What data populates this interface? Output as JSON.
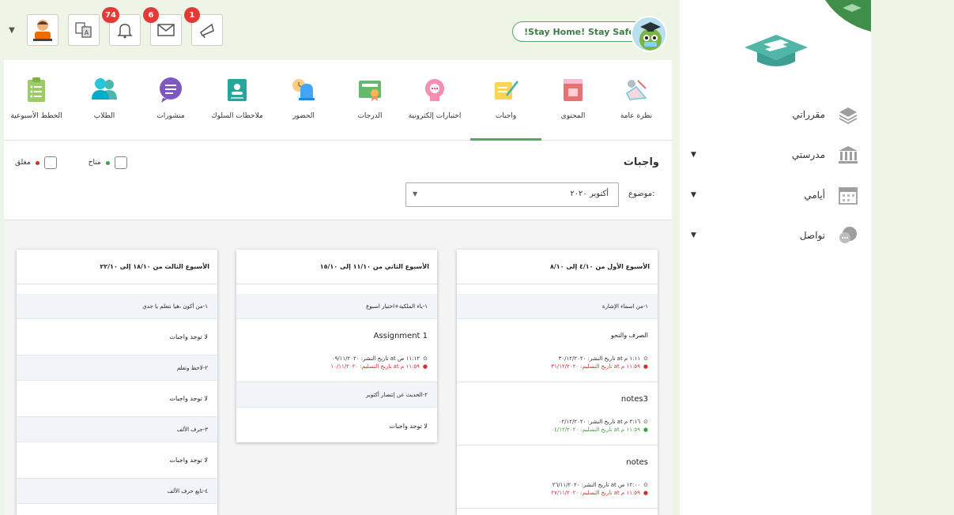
{
  "header": {
    "banner_text": "!Stay Home! Stay Safe",
    "badges": {
      "notifications": "74",
      "messages": "6",
      "announcements": "1"
    }
  },
  "tabs": [
    {
      "key": "overview",
      "label": "نظرة عامة"
    },
    {
      "key": "content",
      "label": "المحتوى"
    },
    {
      "key": "homework",
      "label": "واجبات"
    },
    {
      "key": "exams",
      "label": "اختبارات إلكترونية"
    },
    {
      "key": "grades",
      "label": "الدرجات"
    },
    {
      "key": "attendance",
      "label": "الحضور"
    },
    {
      "key": "behavior",
      "label": "ملاحظات السلوك"
    },
    {
      "key": "posts",
      "label": "منشورات"
    },
    {
      "key": "students",
      "label": "الطلاب"
    },
    {
      "key": "plans",
      "label": "الخطط الأسبوعية"
    }
  ],
  "page": {
    "title": "واجبات",
    "legend_available": "متاح",
    "legend_closed": "مغلق",
    "topic_label": "موضوع:",
    "topic_value": "أكتوبر ٢٠٢٠"
  },
  "colors": {
    "accent_green": "#5aa469",
    "badge_red": "#e53935",
    "due_red": "#d32f2f",
    "due_green": "#43a047"
  },
  "weeks": [
    {
      "title": "الأسبوع الأول من ٤/١٠ إلى ٨/١٠",
      "lesson": "١-من اسماء الإشارة",
      "items": [
        {
          "name": "الصرف والنحو",
          "published": "تاريخ النشر: ٣٠/١٢/٢٠٢٠ at ١:١١ م",
          "due": "تاريخ التسليم: ٣١/١٢/٢٠٢٠ at ١١:٥٩ م",
          "status": "red"
        },
        {
          "name": "notes3",
          "published": "تاريخ النشر: ٠٢/١٢/٢٠٢٠ at ٢:١٦ م",
          "due": "تاريخ التسليم: ٠٤/١٢/٢٠٢٠ at ١١:٥٩ م",
          "status": "green"
        },
        {
          "name": "notes",
          "published": "تاريخ النشر: ٢٦/١١/٢٠٢٠ at ١٢:٠٠ ص",
          "due": "تاريخ التسليم: ٢٧/١١/٢٠٢٠ at ١١:٥٩ م",
          "status": "red"
        }
      ]
    },
    {
      "title": "الأسبوع الثاني من ١١/١٠ إلى ١٥/١٠",
      "lessons": [
        {
          "title": "١-ياء الملكية+اختبار اسبوع",
          "item": {
            "name": "Assignment 1",
            "published": "تاريخ النشر: ٠٩/١١/٢٠٢٠ at ١١:١٢ ص",
            "due": "تاريخ التسليم: ١٠/١١/٢٠٢٠ at ١١:٥٩ م",
            "status": "red"
          }
        },
        {
          "title": "٢-الحديث عن إنتصار أكتوبر",
          "empty": "لا توجد واجبات"
        }
      ]
    },
    {
      "title": "الأسبوع الثالث من ١٨/١٠ إلى ٢٢/١٠",
      "lessons": [
        {
          "title": "١-من أكون ،هيا نتعلم يا جدي",
          "empty": "لا توجد واجبات"
        },
        {
          "title": "٢-لاحظ وتعلم",
          "empty": "لا توجد واجبات"
        },
        {
          "title": "٣-حرف الألف",
          "empty": "لا توجد واجبات"
        },
        {
          "title": "٤-تابع حرف الألف"
        }
      ]
    }
  ],
  "sidebar": {
    "items": [
      {
        "label": "مقرراتي"
      },
      {
        "label": "مدرستي"
      },
      {
        "label": "أيامي"
      },
      {
        "label": "تواصل"
      }
    ]
  }
}
